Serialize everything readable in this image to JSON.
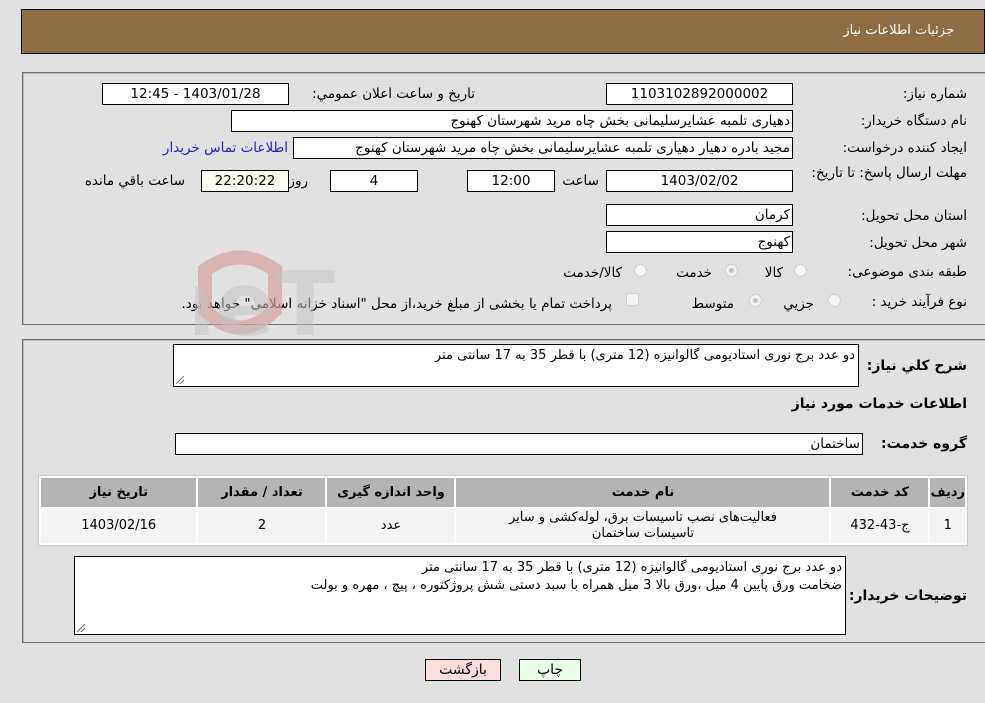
{
  "header": {
    "title": "جزئیات اطلاعات نیاز"
  },
  "form": {
    "need_number": {
      "label": "شماره نیاز:",
      "value": "1103102892000002"
    },
    "announce_datetime": {
      "label": "تاریخ و ساعت اعلان عمومي:",
      "value": "1403/01/28 - 12:45"
    },
    "buyer_org": {
      "label": "نام دستگاه خریدار:",
      "value": "دهیاری تلمبه عشایرسلیمانی بخش چاه مرید شهرستان کهنوج"
    },
    "requester": {
      "label": "ایجاد کننده درخواست:",
      "value": "مجید بادره دهیار دهیاری تلمبه عشایرسلیمانی بخش چاه مرید شهرستان کهنوج"
    },
    "contact_link": "اطلاعات تماس خریدار",
    "deadline": {
      "label": "مهلت ارسال پاسخ: تا تاریخ:",
      "date": "1403/02/02",
      "time_label": "ساعت",
      "time": "12:00",
      "days": "4",
      "days_label": "روز و",
      "remaining": "22:20:22",
      "remaining_label": "ساعت باقي مانده"
    },
    "province": {
      "label": "استان محل تحویل:",
      "value": "کرمان"
    },
    "city": {
      "label": "شهر محل تحویل:",
      "value": "کهنوج"
    },
    "category": {
      "label": "طبقه بندی موضوعی:",
      "options": [
        "کالا",
        "خدمت",
        "کالا/خدمت"
      ],
      "selected": "خدمت"
    },
    "purchase_type": {
      "label": "نوع فرآیند خرید :",
      "options": [
        "جزيي",
        "متوسط"
      ],
      "selected": "متوسط",
      "treasury_note": "پرداخت تمام یا بخشی از مبلغ خرید،از محل \"اسناد خزانه اسلامی\" خواهد بود."
    }
  },
  "details": {
    "summary_label": "شرح کلي نیاز:",
    "summary_value": "دو عدد برج نوری استادیومی گالوانیزه (12 متری)  با قطر 35 به 17 سانتی متر",
    "services_heading": "اطلاعات خدمات مورد نیاز",
    "service_group_label": "گروه خدمت:",
    "service_group_value": "ساختمان",
    "table": {
      "headers": [
        "ردیف",
        "کد خدمت",
        "نام خدمت",
        "واحد اندازه گیری",
        "تعداد / مقدار",
        "تاریخ نیاز"
      ],
      "rows": [
        [
          "1",
          "ج-43-432",
          "فعالیت‌های نصب تاسیسات برق، لوله‌کشی و سایر تاسیسات ساختمان",
          "عدد",
          "2",
          "1403/02/16"
        ]
      ]
    },
    "buyer_notes_label": "توضیحات خریدار:",
    "buyer_notes_line1": "دو عدد برج نوری استادیومی گالوانیزه (12 متری)  با قطر 35 به 17 سانتی متر",
    "buyer_notes_line2": "ضخامت ورق پایین 4 میل ،ورق بالا 3 میل همراه با سبد دستی شش پروژکتوره ، پیچ ، مهره و بولت"
  },
  "buttons": {
    "print": "چاپ",
    "back": "بازگشت"
  },
  "watermark": {
    "text": "AriaTender.neT",
    "color_red": "#d9a0a0",
    "color_gray": "#c4c4c4"
  }
}
